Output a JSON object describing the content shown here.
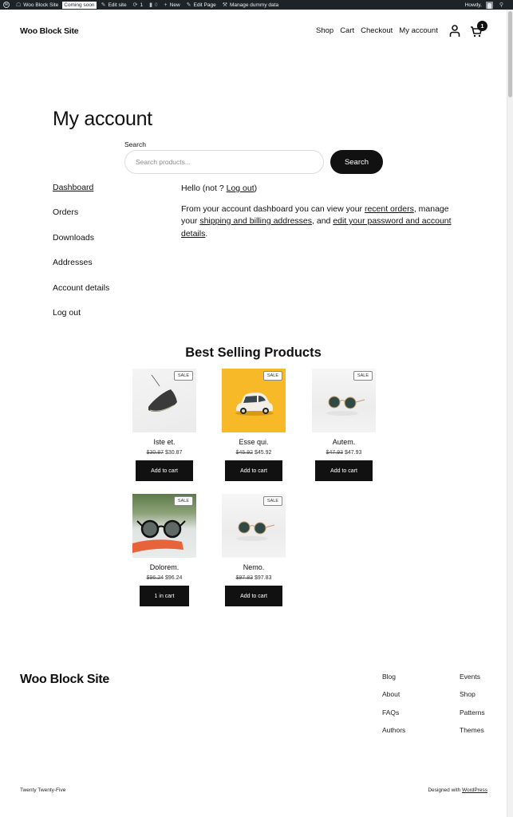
{
  "admin_bar": {
    "site_name": "Woo Block Site",
    "coming_soon": "Coming soon",
    "edit_site": "Edit site",
    "updates_count": "1",
    "comments_count": "0",
    "new": "New",
    "edit_page": "Edit Page",
    "manage_dummy": "Manage dummy data",
    "howdy": "Howdy,"
  },
  "header": {
    "site_title": "Woo Block Site",
    "nav": [
      "Shop",
      "Cart",
      "Checkout",
      "My account"
    ],
    "cart_count": "1"
  },
  "main": {
    "page_title": "My account",
    "search": {
      "label": "Search",
      "placeholder": "Search products...",
      "button": "Search"
    },
    "account_nav": [
      {
        "label": "Dashboard",
        "active": true
      },
      {
        "label": "Orders"
      },
      {
        "label": "Downloads"
      },
      {
        "label": "Addresses"
      },
      {
        "label": "Account details"
      },
      {
        "label": "Log out"
      }
    ],
    "content": {
      "hello_prefix": "Hello (not ? ",
      "hello_logout": "Log out",
      "hello_suffix": ")",
      "intro_1": "From your account dashboard you can view your ",
      "link_recent_orders": "recent orders",
      "intro_2": ", manage your ",
      "link_addresses": "shipping and billing addresses",
      "intro_3": ", and ",
      "link_account": "edit your password and account details",
      "intro_4": "."
    }
  },
  "best_selling": {
    "title": "Best Selling Products",
    "products": [
      {
        "name": "Iste et.",
        "regular_price": "$30.87",
        "sale_price": "$30.87",
        "badge": "SALE",
        "button": "Add to cart",
        "image": "sneaker"
      },
      {
        "name": "Esse qui.",
        "regular_price": "$45.92",
        "sale_price": "$45.92",
        "badge": "SALE",
        "button": "Add to cart",
        "image": "toy-car"
      },
      {
        "name": "Autem.",
        "regular_price": "$47.93",
        "sale_price": "$47.93",
        "badge": "SALE",
        "button": "Add to cart",
        "image": "sunglasses"
      },
      {
        "name": "Dolorem.",
        "regular_price": "$96.24",
        "sale_price": "$96.24",
        "badge": "SALE",
        "button": "1 in cart",
        "image": "dark-sunglasses"
      },
      {
        "name": "Nemo.",
        "regular_price": "$97.83",
        "sale_price": "$97.83",
        "badge": "SALE",
        "button": "Add to cart",
        "image": "sunglasses"
      }
    ]
  },
  "footer": {
    "site_title": "Woo Block Site",
    "col1": [
      "Blog",
      "About",
      "FAQs",
      "Authors"
    ],
    "col2": [
      "Events",
      "Shop",
      "Patterns",
      "Themes"
    ],
    "theme_name": "Twenty Twenty-Five",
    "designed_with": "Designed with ",
    "wordpress_link": "WordPress"
  }
}
